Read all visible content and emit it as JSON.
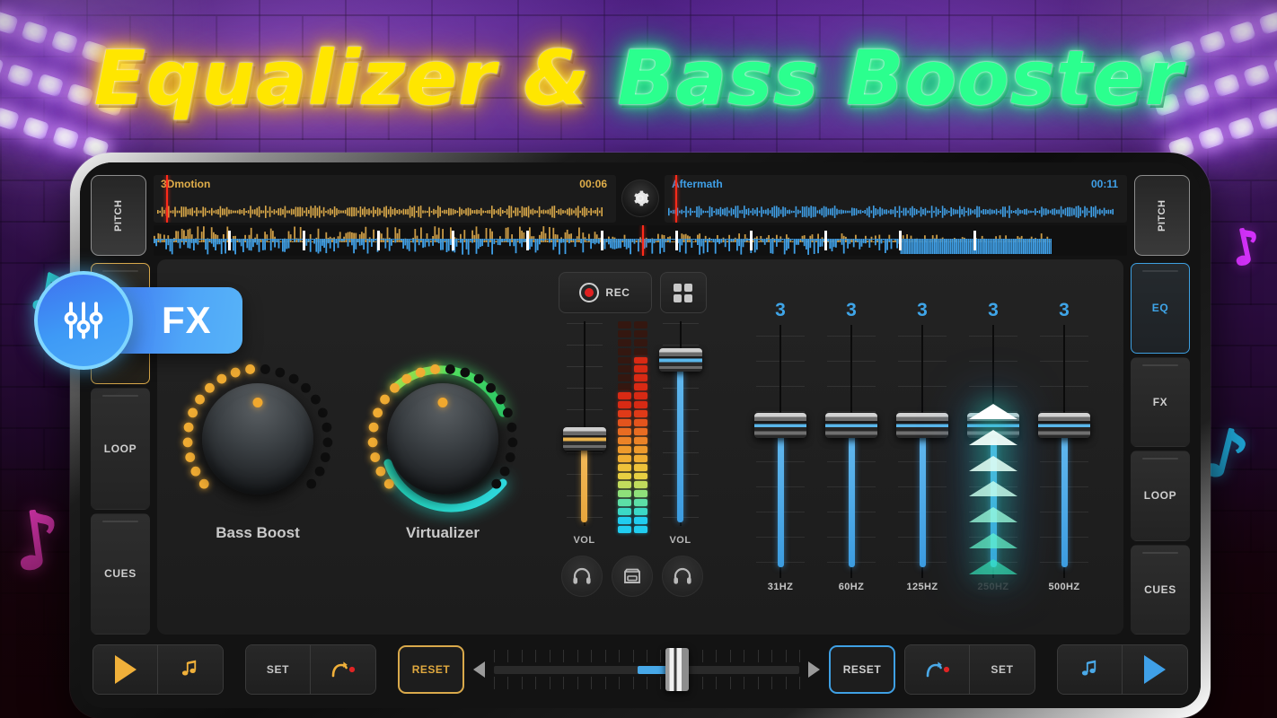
{
  "title": {
    "part1": "Equalizer &",
    "part2": "Bass Booster"
  },
  "decks": {
    "left": {
      "track": "3Dmotion",
      "time": "00:06",
      "pitch_label": "PITCH",
      "color": "#e0ae4a"
    },
    "right": {
      "track": "Aftermath",
      "time": "00:11",
      "pitch_label": "PITCH",
      "color": "#3fa0e8"
    },
    "settings_icon": "gear-icon"
  },
  "left_tabs": [
    {
      "label": "FX",
      "state": "active"
    },
    {
      "label": "LOOP",
      "state": "inactive"
    },
    {
      "label": "CUES",
      "state": "inactive"
    }
  ],
  "right_tabs": [
    {
      "label": "EQ",
      "state": "active"
    },
    {
      "label": "FX",
      "state": "inactive"
    },
    {
      "label": "LOOP",
      "state": "inactive"
    },
    {
      "label": "CUES",
      "state": "inactive"
    }
  ],
  "fx_badge": {
    "label": "FX",
    "icon": "sliders-icon"
  },
  "fx_panel": {
    "knobs": [
      {
        "label": "Bass Boost",
        "icon": "rotary-knob"
      },
      {
        "label": "Virtualizer",
        "icon": "rotary-knob"
      }
    ]
  },
  "mixer": {
    "rec_label": "REC",
    "rec_icon": "record-icon",
    "pads_icon": "grid-icon",
    "left_fader": {
      "label": "VOL",
      "color": "#f0b248"
    },
    "right_fader": {
      "label": "VOL",
      "color": "#4aa9e8"
    },
    "cue_left_icon": "headphones-icon",
    "crate_icon": "record-crate-icon",
    "cue_right_icon": "headphones-icon"
  },
  "equalizer": {
    "bands": [
      {
        "freq": "31HZ",
        "value": "3"
      },
      {
        "freq": "60HZ",
        "value": "3"
      },
      {
        "freq": "125HZ",
        "value": "3"
      },
      {
        "freq": "250HZ",
        "value": "3"
      },
      {
        "freq": "500HZ",
        "value": "3"
      }
    ],
    "highlight_band_index": 3,
    "highlight_icon": "up-arrows-icon",
    "value_color": "#3fa5e8"
  },
  "transport": {
    "left": {
      "play_icon": "play-icon",
      "library_icon": "music-notes-icon",
      "set_label": "SET",
      "loop_icon": "loop-record-icon",
      "reset_label": "RESET"
    },
    "right": {
      "reset_label": "RESET",
      "loop_icon": "loop-record-icon",
      "set_label": "SET",
      "library_icon": "music-notes-icon",
      "play_icon": "play-icon"
    },
    "crossfader": {
      "left_arrow": "prev-icon",
      "right_arrow": "next-icon",
      "position_percent": 60
    }
  },
  "colors": {
    "gold": "#e0a93f",
    "blue": "#3fa0e8",
    "green": "#2bff8e",
    "yellow": "#ffe600",
    "red": "#e02020"
  }
}
